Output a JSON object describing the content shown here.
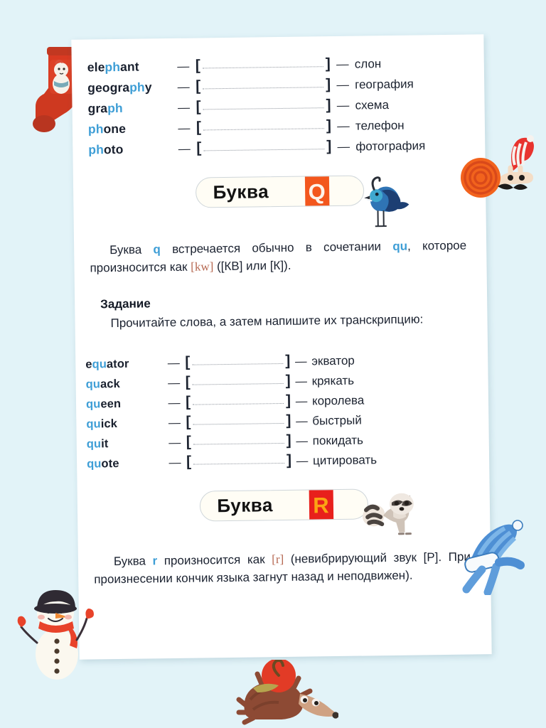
{
  "background": {
    "color": "#e2f3f8",
    "page_color": "#ffffff"
  },
  "colors": {
    "accent_blue": "#3e9ed6",
    "ink": "#1b2230",
    "ipa_red": "#b5664f",
    "badge_orange": "#f3571d",
    "badge_red": "#e8201c",
    "badge_letter_yellow": "#fba414"
  },
  "ph_section": {
    "rows": [
      {
        "term_pre": "ele",
        "term_hl": "ph",
        "term_post": "ant",
        "dash": "—",
        "open": "[",
        "close": "]",
        "dash2": "—",
        "translation": "слон"
      },
      {
        "term_pre": "geogra",
        "term_hl": "ph",
        "term_post": "y",
        "dash": "—",
        "open": "[",
        "close": "]",
        "dash2": "—",
        "translation": "география"
      },
      {
        "term_pre": "gra",
        "term_hl": "ph",
        "term_post": "",
        "dash": "—",
        "open": "[",
        "close": "]",
        "dash2": "—",
        "translation": "схема"
      },
      {
        "term_pre": "",
        "term_hl": "ph",
        "term_post": "one",
        "dash": "—",
        "open": "[",
        "close": "]",
        "dash2": "—",
        "translation": "телефон"
      },
      {
        "term_pre": "",
        "term_hl": "ph",
        "term_post": "oto",
        "dash": "—",
        "open": "[",
        "close": "]",
        "dash2": "—",
        "translation": "фотография"
      }
    ]
  },
  "q_badge": {
    "label": "Буква",
    "letter": "Q",
    "animal": "quail-bird-icon"
  },
  "q_intro": {
    "part1": "Буква ",
    "blue1": "q",
    "part2": " встречается обычно в сочетании ",
    "blue2": "qu",
    "part3": ", которое произносится как ",
    "ipa": "[kw]",
    "part4": " ([КВ] или [К])."
  },
  "task": {
    "heading": "Задание",
    "text": "Прочитайте слова, а затем напишите их транскрипцию:"
  },
  "qu_section": {
    "rows": [
      {
        "term_pre": "e",
        "term_hl": "qu",
        "term_post": "ator",
        "dash": "—",
        "open": "[",
        "close": "]",
        "dash2": "—",
        "translation": "экватор"
      },
      {
        "term_pre": "",
        "term_hl": "qu",
        "term_post": "ack",
        "dash": "—",
        "open": "[",
        "close": "]",
        "dash2": "—",
        "translation": "крякать"
      },
      {
        "term_pre": "",
        "term_hl": "qu",
        "term_post": "een",
        "dash": "—",
        "open": "[",
        "close": "]",
        "dash2": "—",
        "translation": "королева"
      },
      {
        "term_pre": "",
        "term_hl": "qu",
        "term_post": "ick",
        "dash": "—",
        "open": "[",
        "close": "]",
        "dash2": "—",
        "translation": "быстрый"
      },
      {
        "term_pre": "",
        "term_hl": "qu",
        "term_post": "it",
        "dash": "—",
        "open": "[",
        "close": "]",
        "dash2": "—",
        "translation": "покидать"
      },
      {
        "term_pre": "",
        "term_hl": "qu",
        "term_post": "ote",
        "dash": "—",
        "open": "[",
        "close": "]",
        "dash2": "—",
        "translation": "цитировать"
      }
    ]
  },
  "r_badge": {
    "label": "Буква",
    "letter": "R",
    "animal": "raccoon-icon"
  },
  "r_intro": {
    "part1": "Буква ",
    "blue1": "r",
    "part2": " произносится как ",
    "ipa": "[r]",
    "part3": " (невибрирующий звук [Р]. При произнесении кончик языка загнут назад и неподвижен)."
  },
  "decorations": [
    {
      "name": "christmas-sock-icon"
    },
    {
      "name": "snail-icon"
    },
    {
      "name": "winter-hat-icon"
    },
    {
      "name": "snowman-icon"
    },
    {
      "name": "hedgehog-icon"
    }
  ]
}
